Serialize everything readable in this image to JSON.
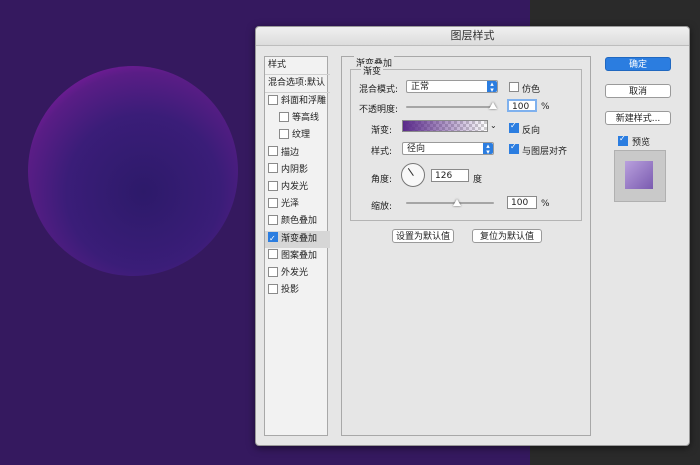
{
  "dialog": {
    "title": "图层样式"
  },
  "left_panel": {
    "header_styles": "样式",
    "header_blending": "混合选项:默认",
    "items": [
      {
        "label": "斜面和浮雕",
        "checked": false,
        "indent": false
      },
      {
        "label": "等高线",
        "checked": false,
        "indent": true
      },
      {
        "label": "纹理",
        "checked": false,
        "indent": true
      },
      {
        "label": "描边",
        "checked": false,
        "indent": false
      },
      {
        "label": "内阴影",
        "checked": false,
        "indent": false
      },
      {
        "label": "内发光",
        "checked": false,
        "indent": false
      },
      {
        "label": "光泽",
        "checked": false,
        "indent": false
      },
      {
        "label": "颜色叠加",
        "checked": false,
        "indent": false
      },
      {
        "label": "渐变叠加",
        "checked": true,
        "indent": false
      },
      {
        "label": "图案叠加",
        "checked": false,
        "indent": false
      },
      {
        "label": "外发光",
        "checked": false,
        "indent": false
      },
      {
        "label": "投影",
        "checked": false,
        "indent": false
      }
    ]
  },
  "main": {
    "group_title": "渐变叠加",
    "sub_title": "渐变",
    "blend_mode_label": "混合模式:",
    "blend_mode_value": "正常",
    "dither_label": "仿色",
    "opacity_label": "不透明度:",
    "opacity_value": "100",
    "opacity_unit": "%",
    "gradient_label": "渐变:",
    "reverse_label": "反向",
    "style_label": "样式:",
    "style_value": "径向",
    "align_label": "与图层对齐",
    "angle_label": "角度:",
    "angle_value": "126",
    "angle_unit": "度",
    "scale_label": "缩放:",
    "scale_value": "100",
    "scale_unit": "%",
    "set_default_btn": "设置为默认值",
    "reset_default_btn": "复位为默认值"
  },
  "right": {
    "ok": "确定",
    "cancel": "取消",
    "new_style": "新建样式...",
    "preview_label": "预览"
  },
  "colors": {
    "accent": "#2b7de0",
    "canvas": "#35195f"
  }
}
